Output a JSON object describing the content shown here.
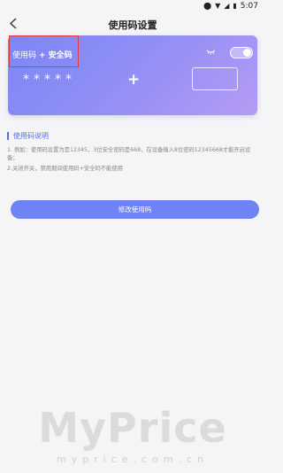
{
  "status_bar": {
    "time": "5:07"
  },
  "header": {
    "title": "使用码设置"
  },
  "card": {
    "label_code": "使用码",
    "label_plus": "+",
    "label_safe": "安全码",
    "masked_value": "*****",
    "plus_sign": "+",
    "toggle_on": true
  },
  "instructions": {
    "title": "使用码说明",
    "line1": "1. 例如：使用码设置为是12345，3位安全密码是668，在设备输入8位密码12345668才能开启设备；",
    "line1b": "备；",
    "line2": "2.关闭开关，禁用期间使用码+安全码不能使用"
  },
  "button": {
    "label": "修改使用码"
  },
  "watermark": {
    "text": "MyPrice",
    "sub": "myprice.com.cn"
  }
}
